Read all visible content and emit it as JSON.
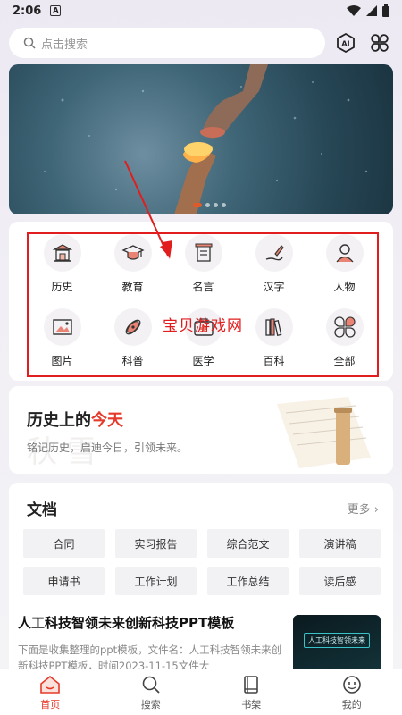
{
  "status": {
    "time": "2:06",
    "notification_badge": "A"
  },
  "search": {
    "placeholder": "点击搜索"
  },
  "top_actions": {
    "ai_label": "AI"
  },
  "banner": {
    "total_slides": 4,
    "active_slide": 1
  },
  "categories": [
    {
      "label": "历史",
      "icon": "history-building-icon"
    },
    {
      "label": "教育",
      "icon": "graduation-cap-icon"
    },
    {
      "label": "名言",
      "icon": "scroll-icon"
    },
    {
      "label": "汉字",
      "icon": "brush-icon"
    },
    {
      "label": "人物",
      "icon": "person-icon"
    },
    {
      "label": "图片",
      "icon": "picture-icon"
    },
    {
      "label": "科普",
      "icon": "rocket-icon"
    },
    {
      "label": "医学",
      "icon": "medical-kit-icon"
    },
    {
      "label": "百科",
      "icon": "books-icon"
    },
    {
      "label": "全部",
      "icon": "grid-all-icon"
    }
  ],
  "watermark": "宝贝游戏网",
  "history_card": {
    "title_prefix": "历史上的",
    "title_highlight": "今天",
    "subtitle": "铭记历史，启迪今日，引领未来。"
  },
  "documents": {
    "title": "文档",
    "more": "更多",
    "tags": [
      "合同",
      "实习报告",
      "综合范文",
      "演讲稿",
      "申请书",
      "工作计划",
      "工作总结",
      "读后感"
    ],
    "article": {
      "title": "人工科技智领未来创新科技PPT模板",
      "desc": "下面是收集整理的ppt模板，文件名：人工科技智领未来创新科技PPT模板，时间2023-11-15文件大",
      "thumb_text": "人工科技智领未来"
    }
  },
  "tabs": [
    {
      "label": "首页",
      "active": true
    },
    {
      "label": "搜索",
      "active": false
    },
    {
      "label": "书架",
      "active": false
    },
    {
      "label": "我的",
      "active": false
    }
  ],
  "colors": {
    "accent": "#e53a2a",
    "frame": "#e11d1d"
  }
}
